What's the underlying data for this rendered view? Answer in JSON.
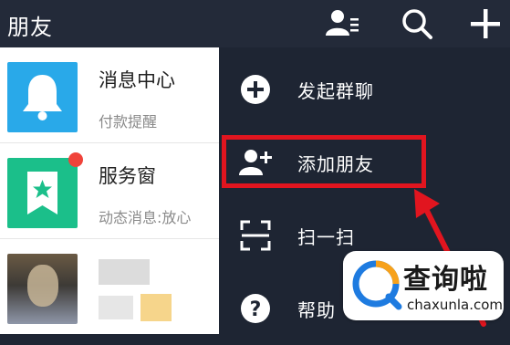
{
  "header": {
    "title": "朋友",
    "icons": [
      "contacts-icon",
      "search-icon",
      "plus-icon"
    ]
  },
  "friend_list": [
    {
      "name": "消息中心",
      "preview": "付款提醒",
      "icon": "bell-icon",
      "color": "#29a9e9"
    },
    {
      "name": "服务窗",
      "preview": "动态消息:放心",
      "icon": "bookmark-star-icon",
      "color": "#1bbf8a",
      "badge": true
    },
    {
      "name": "",
      "preview": "",
      "icon": "avatar-blurred"
    }
  ],
  "menu": {
    "items": [
      {
        "label": "发起群聊",
        "icon": "plus-circle-icon"
      },
      {
        "label": "添加朋友",
        "icon": "add-user-icon"
      },
      {
        "label": "扫一扫",
        "icon": "scan-icon"
      },
      {
        "label": "帮助",
        "icon": "help-icon"
      }
    ],
    "highlighted": "添加朋友"
  },
  "colors": {
    "header_bg": "#232a39",
    "menu_bg": "#1e2533",
    "highlight": "#e1151f"
  },
  "watermark": {
    "cn": "查询啦",
    "en": "chaxunla.com"
  }
}
